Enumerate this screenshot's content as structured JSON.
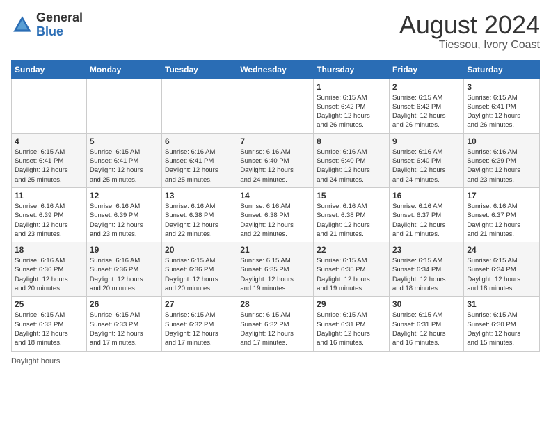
{
  "header": {
    "logo_general": "General",
    "logo_blue": "Blue",
    "month_year": "August 2024",
    "location": "Tiessou, Ivory Coast"
  },
  "footer": {
    "daylight_label": "Daylight hours"
  },
  "days_of_week": [
    "Sunday",
    "Monday",
    "Tuesday",
    "Wednesday",
    "Thursday",
    "Friday",
    "Saturday"
  ],
  "weeks": [
    [
      {
        "day": "",
        "info": ""
      },
      {
        "day": "",
        "info": ""
      },
      {
        "day": "",
        "info": ""
      },
      {
        "day": "",
        "info": ""
      },
      {
        "day": "1",
        "info": "Sunrise: 6:15 AM\nSunset: 6:42 PM\nDaylight: 12 hours\nand 26 minutes."
      },
      {
        "day": "2",
        "info": "Sunrise: 6:15 AM\nSunset: 6:42 PM\nDaylight: 12 hours\nand 26 minutes."
      },
      {
        "day": "3",
        "info": "Sunrise: 6:15 AM\nSunset: 6:41 PM\nDaylight: 12 hours\nand 26 minutes."
      }
    ],
    [
      {
        "day": "4",
        "info": "Sunrise: 6:15 AM\nSunset: 6:41 PM\nDaylight: 12 hours\nand 25 minutes."
      },
      {
        "day": "5",
        "info": "Sunrise: 6:15 AM\nSunset: 6:41 PM\nDaylight: 12 hours\nand 25 minutes."
      },
      {
        "day": "6",
        "info": "Sunrise: 6:16 AM\nSunset: 6:41 PM\nDaylight: 12 hours\nand 25 minutes."
      },
      {
        "day": "7",
        "info": "Sunrise: 6:16 AM\nSunset: 6:40 PM\nDaylight: 12 hours\nand 24 minutes."
      },
      {
        "day": "8",
        "info": "Sunrise: 6:16 AM\nSunset: 6:40 PM\nDaylight: 12 hours\nand 24 minutes."
      },
      {
        "day": "9",
        "info": "Sunrise: 6:16 AM\nSunset: 6:40 PM\nDaylight: 12 hours\nand 24 minutes."
      },
      {
        "day": "10",
        "info": "Sunrise: 6:16 AM\nSunset: 6:39 PM\nDaylight: 12 hours\nand 23 minutes."
      }
    ],
    [
      {
        "day": "11",
        "info": "Sunrise: 6:16 AM\nSunset: 6:39 PM\nDaylight: 12 hours\nand 23 minutes."
      },
      {
        "day": "12",
        "info": "Sunrise: 6:16 AM\nSunset: 6:39 PM\nDaylight: 12 hours\nand 23 minutes."
      },
      {
        "day": "13",
        "info": "Sunrise: 6:16 AM\nSunset: 6:38 PM\nDaylight: 12 hours\nand 22 minutes."
      },
      {
        "day": "14",
        "info": "Sunrise: 6:16 AM\nSunset: 6:38 PM\nDaylight: 12 hours\nand 22 minutes."
      },
      {
        "day": "15",
        "info": "Sunrise: 6:16 AM\nSunset: 6:38 PM\nDaylight: 12 hours\nand 21 minutes."
      },
      {
        "day": "16",
        "info": "Sunrise: 6:16 AM\nSunset: 6:37 PM\nDaylight: 12 hours\nand 21 minutes."
      },
      {
        "day": "17",
        "info": "Sunrise: 6:16 AM\nSunset: 6:37 PM\nDaylight: 12 hours\nand 21 minutes."
      }
    ],
    [
      {
        "day": "18",
        "info": "Sunrise: 6:16 AM\nSunset: 6:36 PM\nDaylight: 12 hours\nand 20 minutes."
      },
      {
        "day": "19",
        "info": "Sunrise: 6:16 AM\nSunset: 6:36 PM\nDaylight: 12 hours\nand 20 minutes."
      },
      {
        "day": "20",
        "info": "Sunrise: 6:15 AM\nSunset: 6:36 PM\nDaylight: 12 hours\nand 20 minutes."
      },
      {
        "day": "21",
        "info": "Sunrise: 6:15 AM\nSunset: 6:35 PM\nDaylight: 12 hours\nand 19 minutes."
      },
      {
        "day": "22",
        "info": "Sunrise: 6:15 AM\nSunset: 6:35 PM\nDaylight: 12 hours\nand 19 minutes."
      },
      {
        "day": "23",
        "info": "Sunrise: 6:15 AM\nSunset: 6:34 PM\nDaylight: 12 hours\nand 18 minutes."
      },
      {
        "day": "24",
        "info": "Sunrise: 6:15 AM\nSunset: 6:34 PM\nDaylight: 12 hours\nand 18 minutes."
      }
    ],
    [
      {
        "day": "25",
        "info": "Sunrise: 6:15 AM\nSunset: 6:33 PM\nDaylight: 12 hours\nand 18 minutes."
      },
      {
        "day": "26",
        "info": "Sunrise: 6:15 AM\nSunset: 6:33 PM\nDaylight: 12 hours\nand 17 minutes."
      },
      {
        "day": "27",
        "info": "Sunrise: 6:15 AM\nSunset: 6:32 PM\nDaylight: 12 hours\nand 17 minutes."
      },
      {
        "day": "28",
        "info": "Sunrise: 6:15 AM\nSunset: 6:32 PM\nDaylight: 12 hours\nand 17 minutes."
      },
      {
        "day": "29",
        "info": "Sunrise: 6:15 AM\nSunset: 6:31 PM\nDaylight: 12 hours\nand 16 minutes."
      },
      {
        "day": "30",
        "info": "Sunrise: 6:15 AM\nSunset: 6:31 PM\nDaylight: 12 hours\nand 16 minutes."
      },
      {
        "day": "31",
        "info": "Sunrise: 6:15 AM\nSunset: 6:30 PM\nDaylight: 12 hours\nand 15 minutes."
      }
    ]
  ]
}
